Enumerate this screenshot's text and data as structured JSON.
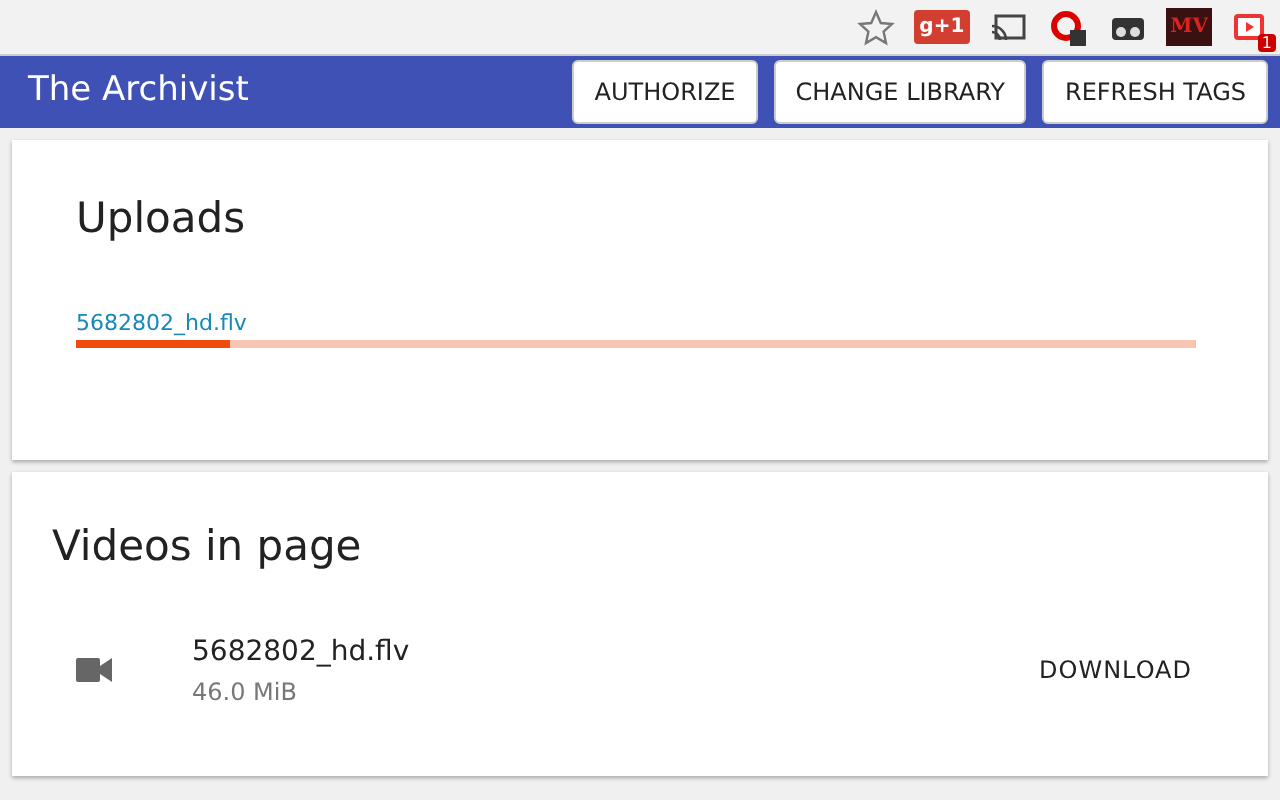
{
  "browser_toolbar": {
    "extension_labels": [
      "g+1",
      "MV"
    ],
    "badge": "1"
  },
  "header": {
    "title": "The Archivist",
    "buttons": [
      "AUTHORIZE",
      "CHANGE LIBRARY",
      "REFRESH TAGS"
    ]
  },
  "uploads": {
    "title": "Uploads",
    "items": [
      {
        "name": "5682802_hd.flv",
        "level": 0.137
      }
    ]
  },
  "videos": {
    "title": "Videos in page",
    "items": [
      {
        "name": "5682802_hd.flv",
        "size": "46.0 MiB",
        "action": "DOWNLOAD"
      }
    ]
  }
}
